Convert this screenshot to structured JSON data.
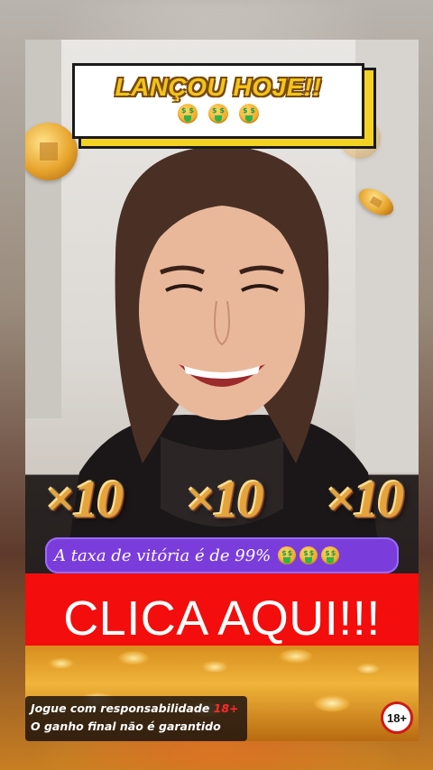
{
  "banner": {
    "title": "LANÇOU HOJE!!",
    "emojis": [
      "money-mouth-face-emoji",
      "money-mouth-face-emoji",
      "money-mouth-face-emoji"
    ]
  },
  "multipliers": [
    "×10",
    "×10",
    "×10"
  ],
  "win_rate": {
    "text": "A taxa de vitória é de 99%",
    "emojis": [
      "money-mouth-face-emoji",
      "money-mouth-face-emoji",
      "money-mouth-face-emoji"
    ]
  },
  "cta": {
    "label": "CLICA AQUI!!!"
  },
  "disclaimer": {
    "line1": "Jogue com responsabilidade",
    "line1_badge": "18+",
    "line2": "O ganho final não é garantido"
  },
  "age_badge": "18+",
  "colors": {
    "cta_red": "#f40d0d",
    "pill_purple": "#7a3ddc",
    "banner_yellow": "#f2c41c",
    "gold": "#e5a33a"
  }
}
